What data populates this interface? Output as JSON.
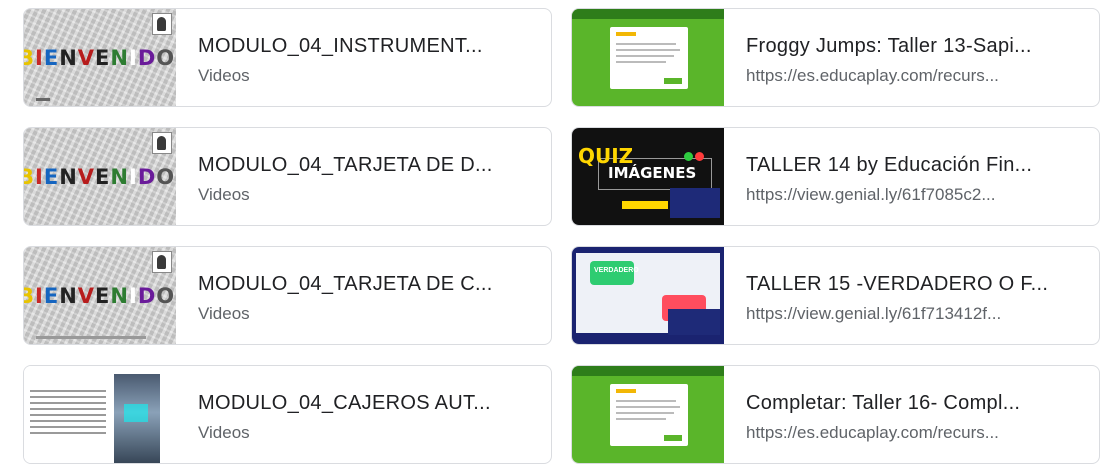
{
  "cards": [
    {
      "title": "MODULO_04_INSTRUMENT...",
      "subtitle": "Videos",
      "thumb": "video",
      "thumb_text": "BIENVENIDOS"
    },
    {
      "title": "Froggy Jumps: Taller 13-Sapi...",
      "subtitle": "https://es.educaplay.com/recurs...",
      "thumb": "educaplay"
    },
    {
      "title": "MODULO_04_TARJETA DE D...",
      "subtitle": "Videos",
      "thumb": "video",
      "thumb_text": "BIENVENIDOS"
    },
    {
      "title": "TALLER 14 by Educación Fin...",
      "subtitle": "https://view.genial.ly/61f7085c2...",
      "thumb": "quiz",
      "thumb_text": [
        "QUIZ",
        "IMÁGENES"
      ]
    },
    {
      "title": "MODULO_04_TARJETA DE C...",
      "subtitle": "Videos",
      "thumb": "video",
      "thumb_text": "BIENVENIDOS"
    },
    {
      "title": "TALLER 15 -VERDADERO O F...",
      "subtitle": "https://view.genial.ly/61f713412f...",
      "thumb": "verdadero",
      "thumb_text": "VERDADERO"
    },
    {
      "title": "MODULO_04_CAJEROS AUT...",
      "subtitle": "Videos",
      "thumb": "atm"
    },
    {
      "title": "Completar: Taller 16- Compl...",
      "subtitle": "https://es.educaplay.com/recurs...",
      "thumb": "educaplay"
    }
  ],
  "colors": {
    "title": "#202124",
    "subtitle": "#5f6368",
    "border": "#dadce0",
    "educaplay_green": "#5ab52a"
  }
}
